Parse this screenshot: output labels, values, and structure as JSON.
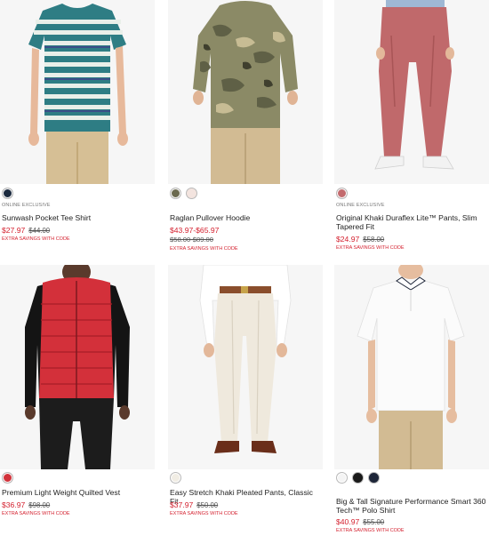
{
  "products": [
    {
      "tag": "ONLINE EXCLUSIVE",
      "name": "Sunwash Pocket Tee Shirt",
      "price": "$27.97",
      "was": "$44.00",
      "was2": "",
      "promo": "EXTRA SAVINGS WITH CODE",
      "swatches": [
        "#1b2a3f"
      ],
      "image": "striped-tee"
    },
    {
      "tag": "",
      "name": "Raglan Pullover Hoodie",
      "price": "$43.97-$65.97",
      "was": "",
      "was2": "$58.00-$89.00",
      "promo": "EXTRA SAVINGS WITH CODE",
      "swatches": [
        "#6b6a4f",
        "#f3e4df"
      ],
      "image": "camo-hoodie"
    },
    {
      "tag": "ONLINE EXCLUSIVE",
      "name": "Original Khaki Duraflex Lite™ Pants, Slim Tapered Fit",
      "price": "$24.97",
      "was": "$58.00",
      "was2": "",
      "promo": "EXTRA SAVINGS WITH CODE",
      "swatches": [
        "#c36b6e"
      ],
      "image": "red-pants"
    },
    {
      "tag": "",
      "name": "Premium Light Weight Quilted Vest",
      "price": "$36.97",
      "was": "$98.00",
      "was2": "",
      "promo": "EXTRA SAVINGS WITH CODE",
      "swatches": [
        "#d2323b"
      ],
      "image": "red-vest"
    },
    {
      "tag": "",
      "name": "Easy Stretch Khaki Pleated Pants, Classic Fit",
      "price": "$37.97",
      "was": "$50.00",
      "was2": "",
      "promo": "EXTRA SAVINGS WITH CODE",
      "swatches": [
        "#f1ede4"
      ],
      "image": "cream-pants"
    },
    {
      "tag": "",
      "name": "Big & Tall Signature Performance Smart 360 Tech™ Polo Shirt",
      "price": "$40.97",
      "was": "$55.00",
      "was2": "",
      "promo": "EXTRA SAVINGS WITH CODE",
      "swatches": [
        "#f4f4f4",
        "#1a1a1a",
        "#1d2538"
      ],
      "image": "white-polo"
    }
  ]
}
